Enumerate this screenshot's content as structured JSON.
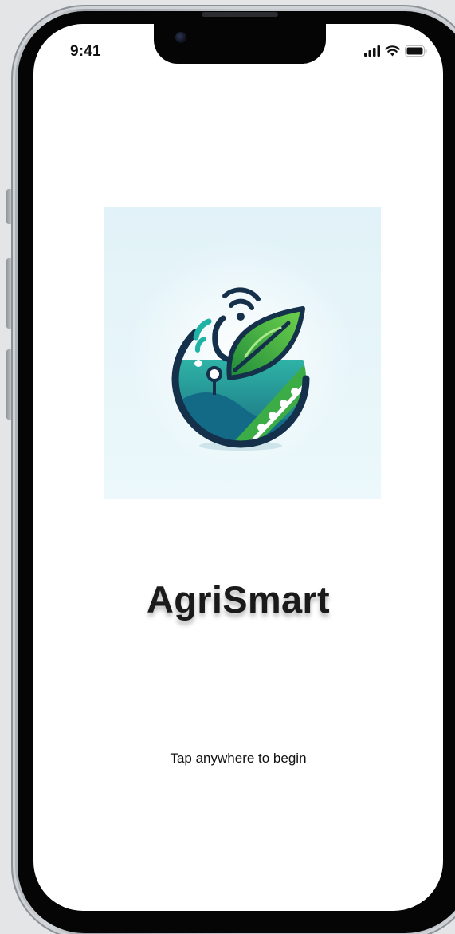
{
  "status_bar": {
    "time": "9:41",
    "icons": [
      "cellular-signal-icon",
      "wifi-icon",
      "battery-icon"
    ]
  },
  "splash": {
    "logo_icon": "agrismart-logo-icon",
    "app_name": "AgriSmart",
    "hint": "Tap anywhere to begin"
  },
  "colors": {
    "background": "#ffffff",
    "logo_background": "#e4f4f9",
    "leaf_green": "#3aa536",
    "teal": "#1f8f8c",
    "navy": "#14304a",
    "text": "#1a1a1a"
  }
}
